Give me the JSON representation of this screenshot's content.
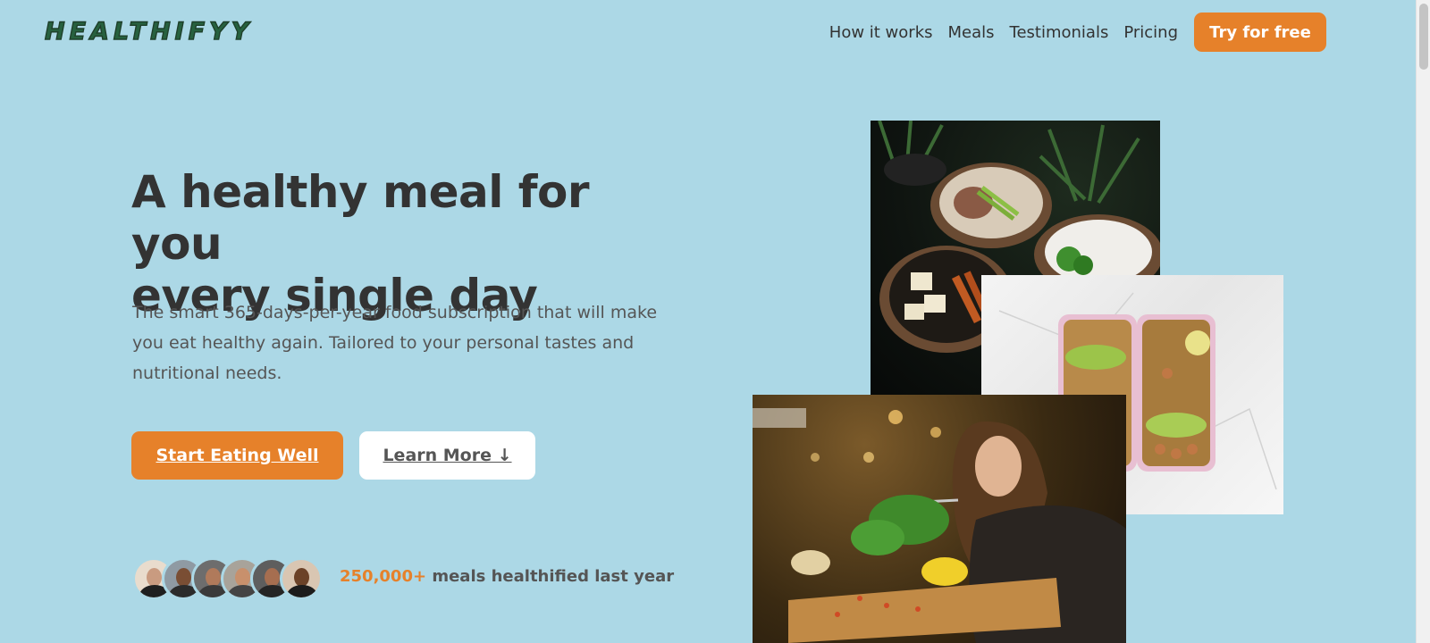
{
  "header": {
    "logo": "HEALTHIFYY",
    "nav": [
      {
        "label": "How it works"
      },
      {
        "label": "Meals"
      },
      {
        "label": "Testimonials"
      },
      {
        "label": "Pricing"
      }
    ],
    "cta_label": "Try for free"
  },
  "hero": {
    "title_line1": "A healthy meal for you",
    "title_line2": "every single day",
    "description": "The smart 365-days-per-year food subscription that will make you eat healthy again. Tailored to your personal tastes and nutritional needs.",
    "primary_button": "Start Eating Well",
    "secondary_button": "Learn More ↓",
    "stat_number": "250,000+",
    "stat_text": " meals healthified last year"
  },
  "colors": {
    "background": "#acd8e6",
    "accent": "#e6812a",
    "logo": "#27613f",
    "text": "#333333"
  },
  "icons": [
    "down-arrow-icon"
  ]
}
